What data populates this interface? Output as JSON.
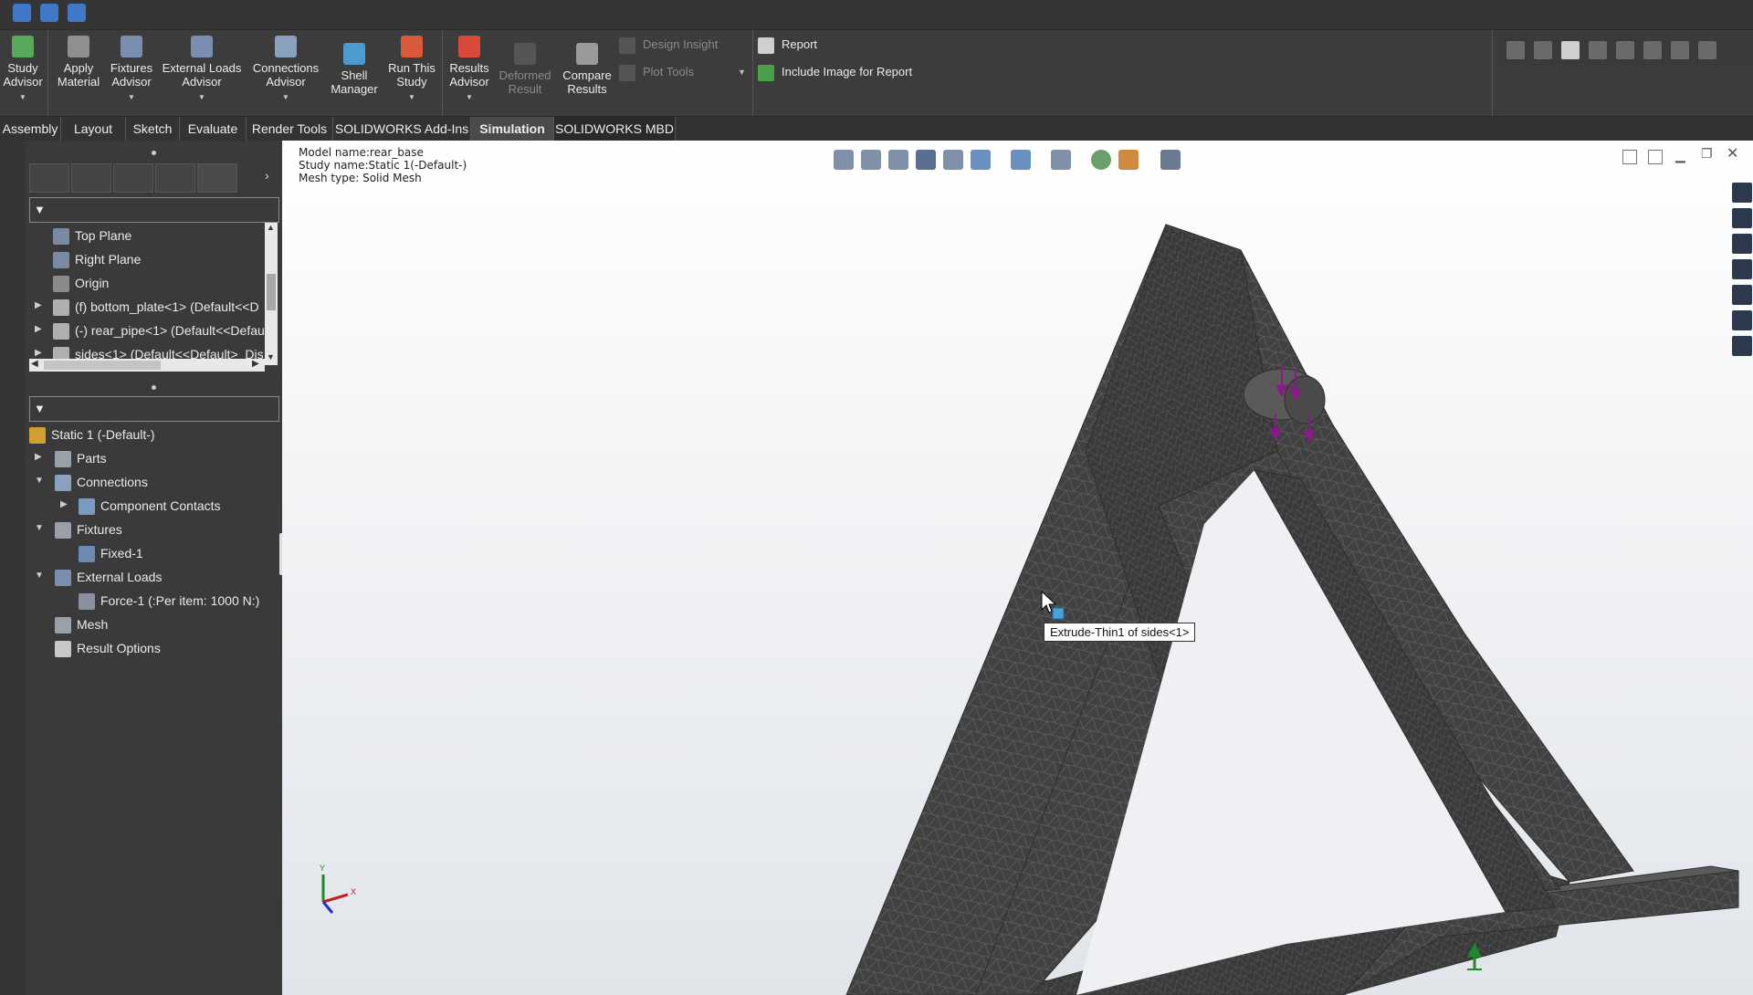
{
  "ribbon": {
    "buttons": [
      {
        "label": "Study\nAdvisor"
      },
      {
        "label": "Apply\nMaterial"
      },
      {
        "label": "Fixtures\nAdvisor"
      },
      {
        "label": "External Loads\nAdvisor"
      },
      {
        "label": "Connections\nAdvisor"
      },
      {
        "label": "Shell\nManager"
      },
      {
        "label": "Run This\nStudy"
      },
      {
        "label": "Results\nAdvisor"
      },
      {
        "label": "Deformed\nResult"
      },
      {
        "label": "Compare\nResults"
      }
    ],
    "design_insight": "Design Insight",
    "plot_tools": "Plot Tools",
    "report": "Report",
    "include_image": "Include Image for Report"
  },
  "tabs": [
    "Assembly",
    "Layout",
    "Sketch",
    "Evaluate",
    "Render Tools",
    "SOLIDWORKS Add-Ins",
    "Simulation",
    "SOLIDWORKS MBD"
  ],
  "tree_top": [
    {
      "label": "Top Plane"
    },
    {
      "label": "Right Plane"
    },
    {
      "label": "Origin"
    },
    {
      "label": "(f) bottom_plate<1> (Default<<D"
    },
    {
      "label": "(-) rear_pipe<1> (Default<<Defau"
    },
    {
      "label": "sides<1> (Default<<Default>_Dis"
    }
  ],
  "tree_study": [
    {
      "label": "Static 1 (-Default-)"
    },
    {
      "label": "Parts"
    },
    {
      "label": "Connections"
    },
    {
      "label": "Component Contacts"
    },
    {
      "label": "Fixtures"
    },
    {
      "label": "Fixed-1"
    },
    {
      "label": "External Loads"
    },
    {
      "label": "Force-1 (:Per item: 1000 N:)"
    },
    {
      "label": "Mesh"
    },
    {
      "label": "Result Options"
    }
  ],
  "viewport": {
    "model_name": "Model name:rear_base",
    "study_name": "Study name:Static 1(-Default-)",
    "mesh_type": "Mesh type: Solid Mesh",
    "tooltip": "Extrude-Thin1 of sides<1>",
    "axis_y": "Y",
    "axis_x": "X"
  },
  "colors": {
    "mesh": "#3f3f3f",
    "load_arrow": "#8a1a8a",
    "fixture_arrow": "#1e8a2a",
    "tooltip_bg": "#ffffff"
  }
}
